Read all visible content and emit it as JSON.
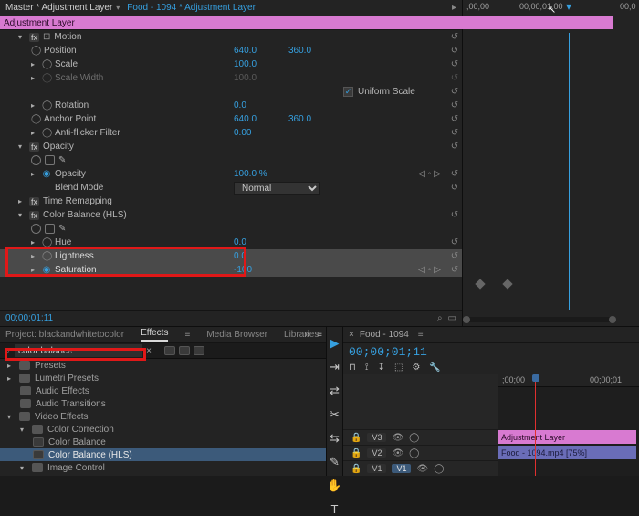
{
  "ec": {
    "master_tab": "Master * Adjustment Layer",
    "clip_tab": "Food - 1094 * Adjustment Layer",
    "section": "Video Effects",
    "motion": {
      "label": "Motion",
      "position_label": "Position",
      "position_x": "640.0",
      "position_y": "360.0",
      "scale_label": "Scale",
      "scale_val": "100.0",
      "scale_w_label": "Scale Width",
      "scale_w_val": "100.0",
      "uniform_label": "Uniform Scale",
      "rotation_label": "Rotation",
      "rotation_val": "0.0",
      "anchor_label": "Anchor Point",
      "anchor_x": "640.0",
      "anchor_y": "360.0",
      "flicker_label": "Anti-flicker Filter",
      "flicker_val": "0.00"
    },
    "opacity": {
      "label": "Opacity",
      "opacity_label": "Opacity",
      "opacity_val": "100.0 %",
      "blend_label": "Blend Mode",
      "blend_val": "Normal"
    },
    "time_remap": {
      "label": "Time Remapping"
    },
    "hls": {
      "label": "Color Balance (HLS)",
      "hue_label": "Hue",
      "hue_val": "0.0",
      "light_label": "Lightness",
      "light_val": "0.0",
      "sat_label": "Saturation",
      "sat_val": "-100"
    },
    "timecode": "00;00;01;11"
  },
  "tl_header": {
    "t0": ";00;00",
    "t1": "00;00;01;00",
    "t2": "00;0",
    "clip_name": "Adjustment Layer"
  },
  "effects": {
    "panel_tab_project": "Project: blackandwhitetocolor",
    "panel_tab_effects": "Effects",
    "panel_tab_media": "Media Browser",
    "panel_tab_libraries": "Libraries",
    "search": "color balance",
    "tree": {
      "presets": "Presets",
      "lumetri": "Lumetri Presets",
      "audio_fx": "Audio Effects",
      "audio_tr": "Audio Transitions",
      "video_fx": "Video Effects",
      "color_corr": "Color Correction",
      "cb": "Color Balance",
      "cb_hls": "Color Balance (HLS)",
      "image_ctrl": "Image Control"
    }
  },
  "program": {
    "seq_name": "Food - 1094",
    "timecode": "00;00;01;11",
    "ruler_t0": ";00;00",
    "ruler_t1": "00;00;01",
    "tracks": {
      "v3": "V3",
      "v2": "V2",
      "v1": "V1",
      "clip_adj": "Adjustment Layer",
      "clip_vid": "Food - 1094.mp4 [75%]"
    }
  }
}
